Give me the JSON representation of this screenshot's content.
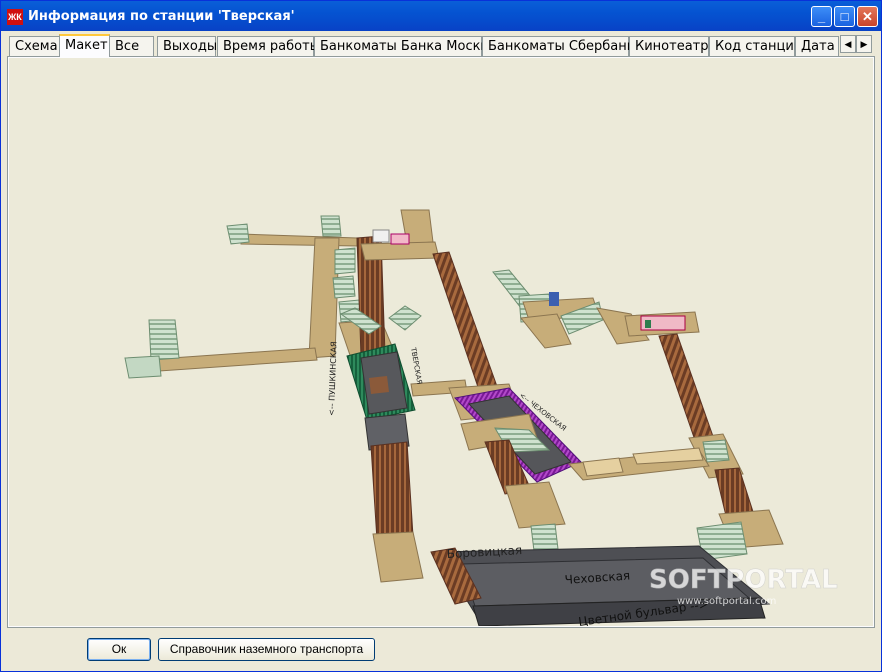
{
  "window": {
    "title": "Информация по станции 'Тверская'",
    "app_icon_text": "ЖК"
  },
  "tabs": [
    {
      "label": "Схема",
      "active": false
    },
    {
      "label": "Макет",
      "active": true
    },
    {
      "label": "Все",
      "active": false
    },
    {
      "label": "Выходы",
      "active": false
    },
    {
      "label": "Время работы",
      "active": false
    },
    {
      "label": "Банкоматы Банка Москвы",
      "active": false
    },
    {
      "label": "Банкоматы Сбербанка",
      "active": false
    },
    {
      "label": "Кинотеатры",
      "active": false
    },
    {
      "label": "Код станции",
      "active": false
    },
    {
      "label": "Дата с",
      "active": false
    }
  ],
  "model": {
    "labels": {
      "borovitskaya": "Боровицкая",
      "chekhovskaya": "Чеховская",
      "tsvetnoy": "Цветной бульвар -->"
    },
    "watermark": {
      "brand": "SOFTPORTAL",
      "url": "www.softportal.com"
    },
    "colors": {
      "floor": "#c8ad7a",
      "wall": "#8b7550",
      "platform": "#55565a",
      "track_green": "#1f6f4a",
      "track_purple": "#8b1fa8",
      "escalator": "#7a4a2e",
      "stairs": "#b9d3bb",
      "background": "#ecead9"
    }
  },
  "buttons": {
    "ok": "Ок",
    "transport": "Справочник наземного транспорта"
  }
}
